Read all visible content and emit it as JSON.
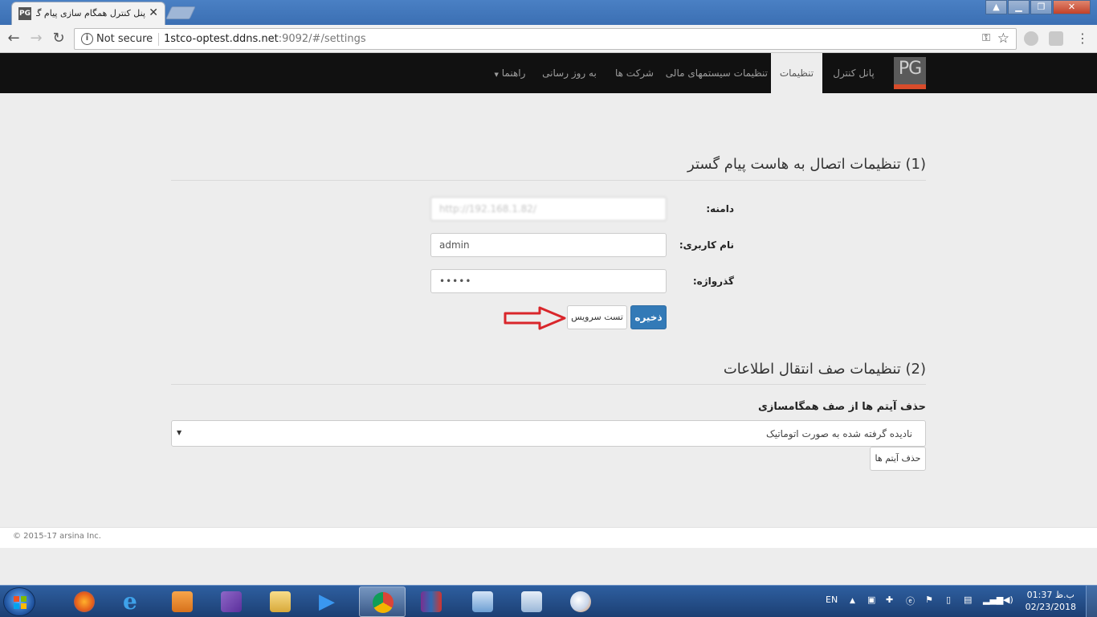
{
  "browser": {
    "tab_title": "پنل کنترل همگام سازی پیام گستر",
    "favicon_text": "PG",
    "tab_close": "✕",
    "not_secure": "Not secure",
    "url_host": "1stco-optest.ddns.net",
    "url_rest": ":9092/#/settings",
    "window_controls": [
      "▲",
      "▁",
      "❐",
      "✕"
    ]
  },
  "navbar": {
    "brand": "PG",
    "items": [
      {
        "label": "پانل کنترل"
      },
      {
        "label": "تنظیمات",
        "active": true
      },
      {
        "label": "تنظیمات سیستمهای مالی"
      },
      {
        "label": "شرکت ها"
      },
      {
        "label": "به روز رسانی"
      },
      {
        "label": "راهنما"
      }
    ],
    "dropdown_caret": "▼"
  },
  "section1": {
    "title": "(1) تنظیمات اتصال به هاست پیام گستر",
    "domain_label": "دامنه:",
    "domain_value": "http://192.168.1.82/",
    "username_label": "نام کاربری:",
    "username_value": "admin",
    "password_label": "گذرواژه:",
    "password_value": "•••••",
    "save_button": "ذخیره",
    "test_button": "تست سرویس"
  },
  "section2": {
    "title": "(2) تنظیمات صف انتقال اطلاعات",
    "queue_label": "حذف آیتم ها از صف همگامسازی",
    "queue_select": "نادیده گرفته شده به صورت اتوماتیک",
    "remove_button": "حذف آیتم ها"
  },
  "footer": {
    "copyright": "© 2015-17 arsina Inc."
  },
  "taskbar": {
    "apps": [
      "firefox",
      "internet-explorer",
      "media-player",
      "visual-studio",
      "file-explorer",
      "play",
      "chrome",
      "winrar",
      "remote-desktop",
      "control-panel",
      "paint"
    ],
    "active_app": "chrome",
    "lang": "EN",
    "time": "01:37 ب.ظ",
    "date": "02/23/2018"
  },
  "colors": {
    "navbar_bg": "#111111",
    "primary_button": "#337ab7",
    "brand_accent": "#d84c2b",
    "arrow": "#d9262b"
  }
}
